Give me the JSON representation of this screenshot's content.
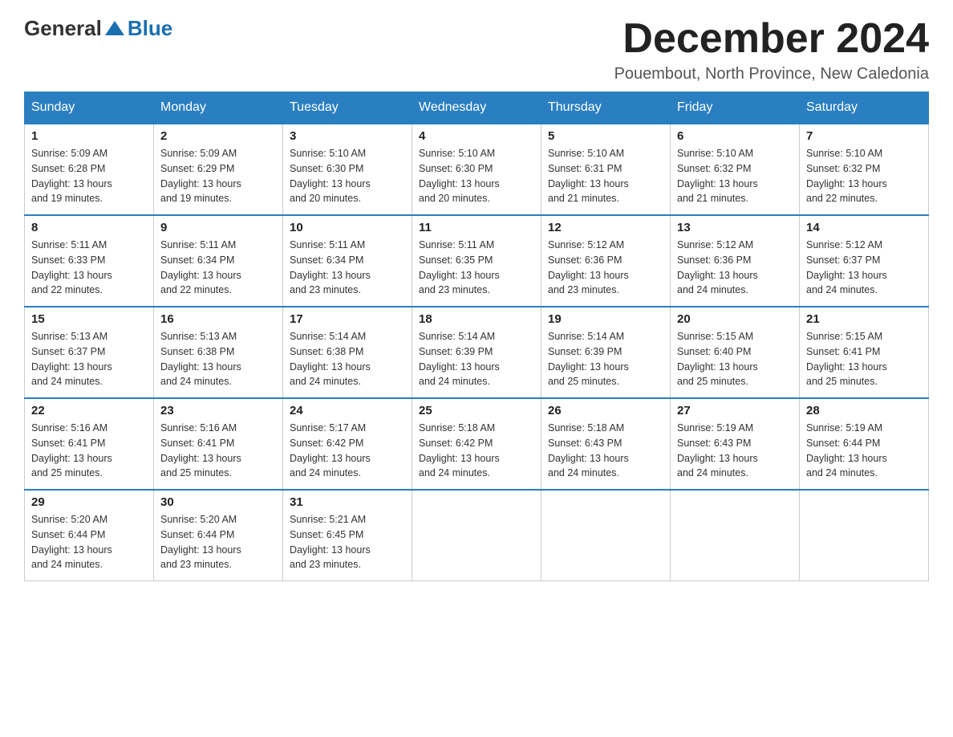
{
  "logo": {
    "general": "General",
    "blue": "Blue"
  },
  "title": "December 2024",
  "location": "Pouembout, North Province, New Caledonia",
  "days_of_week": [
    "Sunday",
    "Monday",
    "Tuesday",
    "Wednesday",
    "Thursday",
    "Friday",
    "Saturday"
  ],
  "weeks": [
    [
      {
        "day": "1",
        "sunrise": "5:09 AM",
        "sunset": "6:28 PM",
        "daylight": "13 hours and 19 minutes."
      },
      {
        "day": "2",
        "sunrise": "5:09 AM",
        "sunset": "6:29 PM",
        "daylight": "13 hours and 19 minutes."
      },
      {
        "day": "3",
        "sunrise": "5:10 AM",
        "sunset": "6:30 PM",
        "daylight": "13 hours and 20 minutes."
      },
      {
        "day": "4",
        "sunrise": "5:10 AM",
        "sunset": "6:30 PM",
        "daylight": "13 hours and 20 minutes."
      },
      {
        "day": "5",
        "sunrise": "5:10 AM",
        "sunset": "6:31 PM",
        "daylight": "13 hours and 21 minutes."
      },
      {
        "day": "6",
        "sunrise": "5:10 AM",
        "sunset": "6:32 PM",
        "daylight": "13 hours and 21 minutes."
      },
      {
        "day": "7",
        "sunrise": "5:10 AM",
        "sunset": "6:32 PM",
        "daylight": "13 hours and 22 minutes."
      }
    ],
    [
      {
        "day": "8",
        "sunrise": "5:11 AM",
        "sunset": "6:33 PM",
        "daylight": "13 hours and 22 minutes."
      },
      {
        "day": "9",
        "sunrise": "5:11 AM",
        "sunset": "6:34 PM",
        "daylight": "13 hours and 22 minutes."
      },
      {
        "day": "10",
        "sunrise": "5:11 AM",
        "sunset": "6:34 PM",
        "daylight": "13 hours and 23 minutes."
      },
      {
        "day": "11",
        "sunrise": "5:11 AM",
        "sunset": "6:35 PM",
        "daylight": "13 hours and 23 minutes."
      },
      {
        "day": "12",
        "sunrise": "5:12 AM",
        "sunset": "6:36 PM",
        "daylight": "13 hours and 23 minutes."
      },
      {
        "day": "13",
        "sunrise": "5:12 AM",
        "sunset": "6:36 PM",
        "daylight": "13 hours and 24 minutes."
      },
      {
        "day": "14",
        "sunrise": "5:12 AM",
        "sunset": "6:37 PM",
        "daylight": "13 hours and 24 minutes."
      }
    ],
    [
      {
        "day": "15",
        "sunrise": "5:13 AM",
        "sunset": "6:37 PM",
        "daylight": "13 hours and 24 minutes."
      },
      {
        "day": "16",
        "sunrise": "5:13 AM",
        "sunset": "6:38 PM",
        "daylight": "13 hours and 24 minutes."
      },
      {
        "day": "17",
        "sunrise": "5:14 AM",
        "sunset": "6:38 PM",
        "daylight": "13 hours and 24 minutes."
      },
      {
        "day": "18",
        "sunrise": "5:14 AM",
        "sunset": "6:39 PM",
        "daylight": "13 hours and 24 minutes."
      },
      {
        "day": "19",
        "sunrise": "5:14 AM",
        "sunset": "6:39 PM",
        "daylight": "13 hours and 25 minutes."
      },
      {
        "day": "20",
        "sunrise": "5:15 AM",
        "sunset": "6:40 PM",
        "daylight": "13 hours and 25 minutes."
      },
      {
        "day": "21",
        "sunrise": "5:15 AM",
        "sunset": "6:41 PM",
        "daylight": "13 hours and 25 minutes."
      }
    ],
    [
      {
        "day": "22",
        "sunrise": "5:16 AM",
        "sunset": "6:41 PM",
        "daylight": "13 hours and 25 minutes."
      },
      {
        "day": "23",
        "sunrise": "5:16 AM",
        "sunset": "6:41 PM",
        "daylight": "13 hours and 25 minutes."
      },
      {
        "day": "24",
        "sunrise": "5:17 AM",
        "sunset": "6:42 PM",
        "daylight": "13 hours and 24 minutes."
      },
      {
        "day": "25",
        "sunrise": "5:18 AM",
        "sunset": "6:42 PM",
        "daylight": "13 hours and 24 minutes."
      },
      {
        "day": "26",
        "sunrise": "5:18 AM",
        "sunset": "6:43 PM",
        "daylight": "13 hours and 24 minutes."
      },
      {
        "day": "27",
        "sunrise": "5:19 AM",
        "sunset": "6:43 PM",
        "daylight": "13 hours and 24 minutes."
      },
      {
        "day": "28",
        "sunrise": "5:19 AM",
        "sunset": "6:44 PM",
        "daylight": "13 hours and 24 minutes."
      }
    ],
    [
      {
        "day": "29",
        "sunrise": "5:20 AM",
        "sunset": "6:44 PM",
        "daylight": "13 hours and 24 minutes."
      },
      {
        "day": "30",
        "sunrise": "5:20 AM",
        "sunset": "6:44 PM",
        "daylight": "13 hours and 23 minutes."
      },
      {
        "day": "31",
        "sunrise": "5:21 AM",
        "sunset": "6:45 PM",
        "daylight": "13 hours and 23 minutes."
      },
      null,
      null,
      null,
      null
    ]
  ],
  "labels": {
    "sunrise": "Sunrise:",
    "sunset": "Sunset:",
    "daylight": "Daylight:"
  }
}
